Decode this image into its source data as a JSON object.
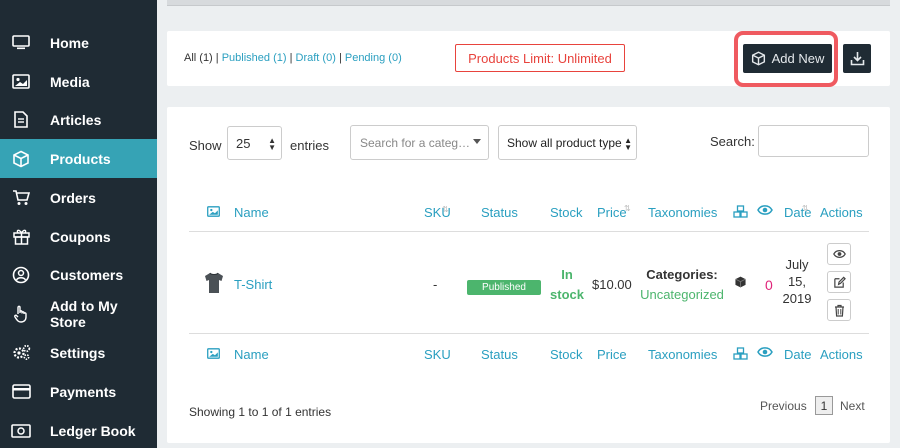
{
  "sidebar": {
    "items": [
      {
        "label": "Home",
        "icon": "monitor-icon"
      },
      {
        "label": "Media",
        "icon": "image-icon"
      },
      {
        "label": "Articles",
        "icon": "document-icon"
      },
      {
        "label": "Products",
        "icon": "cube-icon",
        "active": true
      },
      {
        "label": "Orders",
        "icon": "cart-icon"
      },
      {
        "label": "Coupons",
        "icon": "gift-icon"
      },
      {
        "label": "Customers",
        "icon": "user-circle-icon"
      },
      {
        "label": "Add to My Store",
        "icon": "hand-pointer-icon"
      },
      {
        "label": "Settings",
        "icon": "gears-icon"
      },
      {
        "label": "Payments",
        "icon": "credit-card-icon"
      },
      {
        "label": "Ledger Book",
        "icon": "money-icon"
      }
    ]
  },
  "filters": {
    "all": "All (1)",
    "published": "Published (1)",
    "draft": "Draft (0)",
    "pending": "Pending (0)",
    "separator": "|"
  },
  "limit_label": "Products Limit: Unlimited",
  "add_new_label": "Add New",
  "table_controls": {
    "show_label": "Show",
    "entries_value": "25",
    "entries_label": "entries",
    "category_placeholder": "Search for a categ…",
    "type_select": "Show all product type",
    "search_label": "Search:"
  },
  "columns": {
    "name": "Name",
    "sku": "SKU",
    "status": "Status",
    "stock": "Stock",
    "price": "Price",
    "taxonomies": "Taxonomies",
    "date": "Date",
    "actions": "Actions"
  },
  "rows": [
    {
      "name": "T-Shirt",
      "sku": "-",
      "status": "Published",
      "stock_line1": "In",
      "stock_line2": "stock",
      "price": "$10.00",
      "tax_key": "Categories:",
      "tax_value": "Uncategorized",
      "views": "0",
      "date_line1": "July",
      "date_line2": "15,",
      "date_line3": "2019"
    }
  ],
  "footer": {
    "showing": "Showing 1 to 1 of 1 entries",
    "previous": "Previous",
    "page": "1",
    "next": "Next"
  },
  "colors": {
    "sidebar_bg": "#1f2b34",
    "active_bg": "#36a3b5",
    "link": "#2a9fc0",
    "success": "#4cb56d",
    "danger": "#e8433d",
    "highlight": "#ef5a60",
    "views_count": "#e0247a"
  }
}
